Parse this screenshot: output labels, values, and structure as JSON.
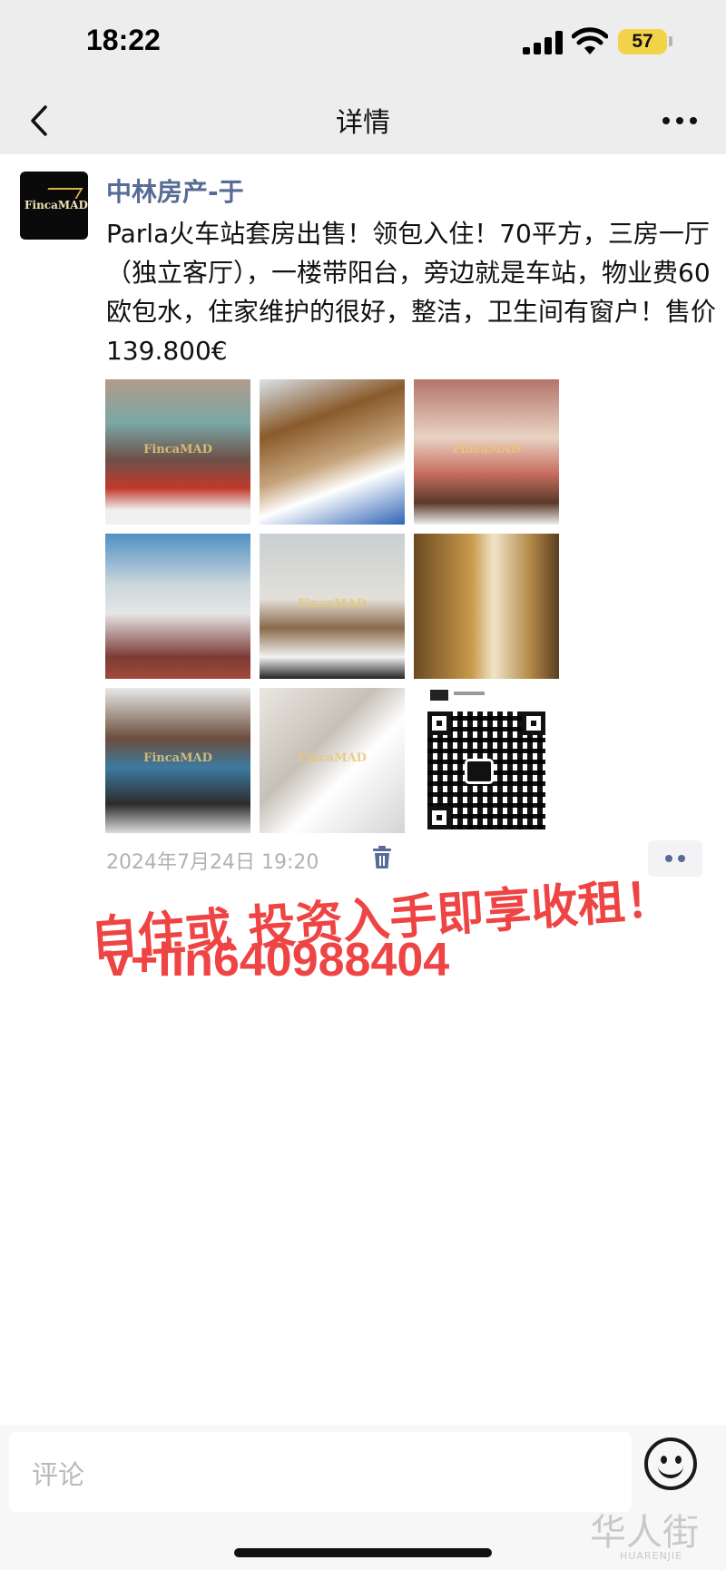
{
  "status_bar": {
    "time": "18:22",
    "battery": "57",
    "signal_icon": "signal-icon",
    "wifi_icon": "wifi-icon"
  },
  "nav": {
    "title": "详情",
    "back_icon": "chevron-left-icon",
    "more_icon": "more-icon"
  },
  "post": {
    "author": "中林房产-于",
    "avatar_brand": "FincaMAD",
    "text": "Parla火车站套房出售！领包入住！70平方，三房一厅（独立客厅），一楼带阳台，旁边就是车站，物业费60欧包水，住家维护的很好，整洁，卫生间有窗户！售价139.800€",
    "photo_watermark": "FincaMAD",
    "timestamp": "2024年7月24日 19:20"
  },
  "overlay": {
    "line1": "自住或 投资入手即享收租！",
    "line2": "v+lin640988404"
  },
  "comment": {
    "placeholder": "评论"
  },
  "watermark": {
    "cn": "华人街",
    "en": "HUARENJIE"
  },
  "colors": {
    "link": "#576b95",
    "overlay_red": "#ef4444",
    "bar_bg": "#ededed",
    "battery": "#f3d34a"
  }
}
